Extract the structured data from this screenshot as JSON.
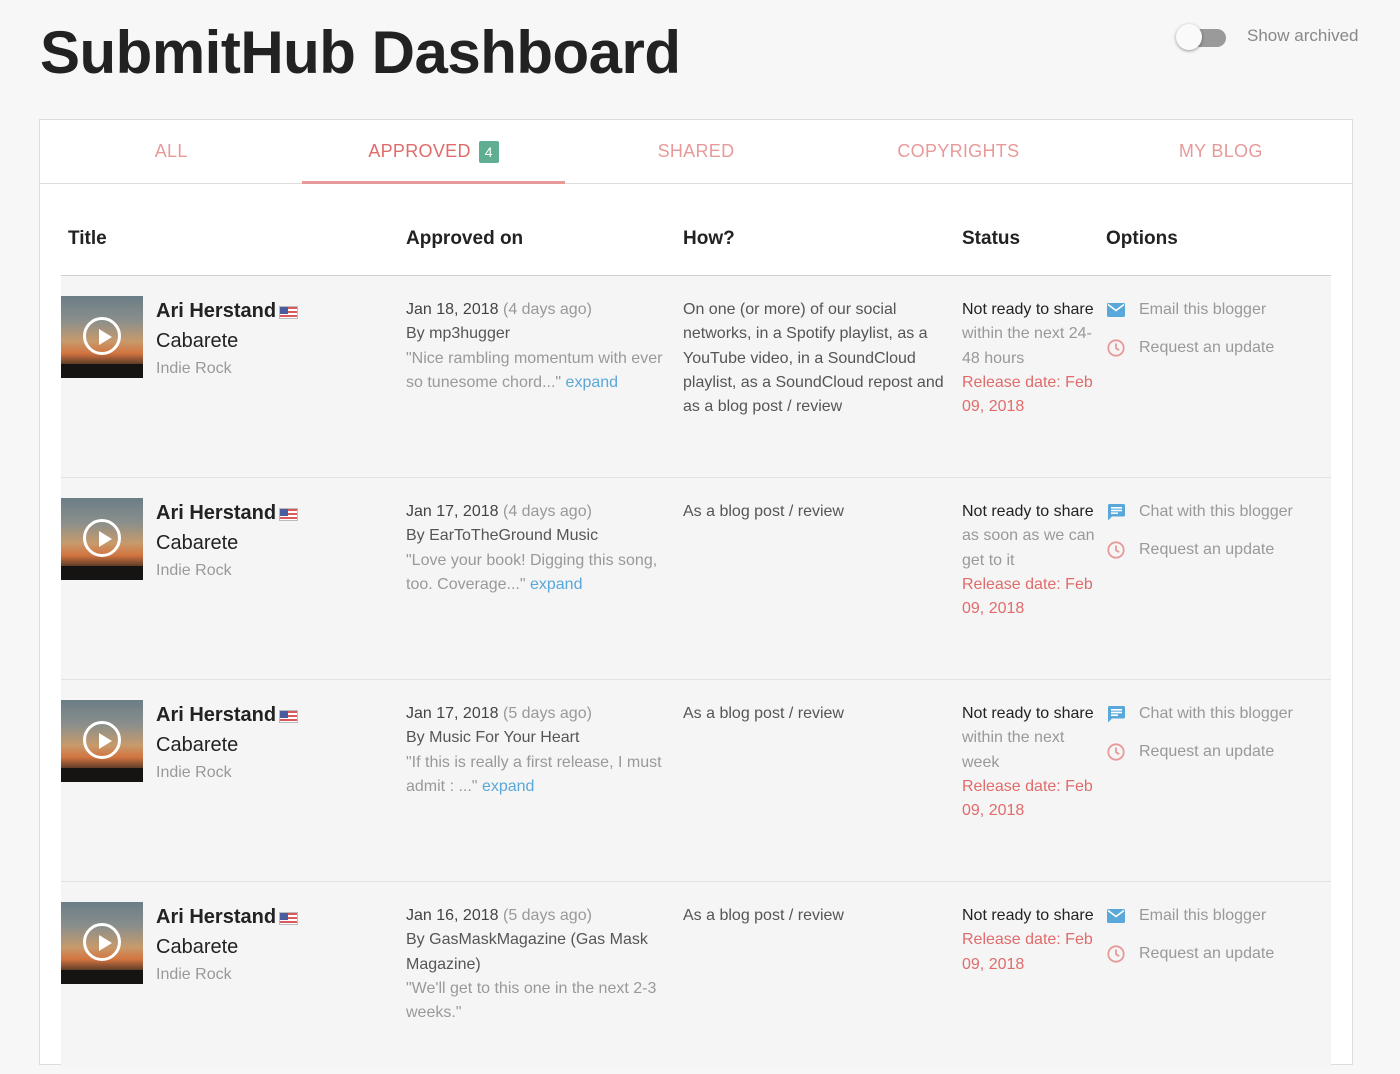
{
  "header": {
    "title": "SubmitHub Dashboard",
    "archive_toggle": {
      "label": "Show archived",
      "checked": false
    }
  },
  "tabs": [
    {
      "label": "ALL",
      "active": false
    },
    {
      "label": "APPROVED",
      "badge": "4",
      "active": true
    },
    {
      "label": "SHARED",
      "active": false
    },
    {
      "label": "COPYRIGHTS",
      "active": false
    },
    {
      "label": "MY BLOG",
      "active": false
    }
  ],
  "table": {
    "columns": [
      "Title",
      "Approved on",
      "How?",
      "Status",
      "Options"
    ],
    "rows": [
      {
        "artist": "Ari Herstand",
        "song": "Cabarete",
        "genre": "Indie Rock",
        "approved_date": "Jan 18, 2018",
        "approved_ago": "(4 days ago)",
        "by": "By mp3hugger",
        "quote": "\"Nice rambling momentum with ever so tunesome chord...\"",
        "expand": "expand",
        "how": "On one (or more) of our social networks, in a Spotify playlist, as a YouTube video, in a SoundCloud playlist, as a SoundCloud repost and as a blog post / review",
        "status": "Not ready to share",
        "timing": "within the next 24-48 hours",
        "release": "Release date: Feb 09, 2018",
        "option1": "Email this blogger",
        "option1_icon": "email-icon",
        "option2": "Request an update",
        "option2_icon": "clock-icon"
      },
      {
        "artist": "Ari Herstand",
        "song": "Cabarete",
        "genre": "Indie Rock",
        "approved_date": "Jan 17, 2018",
        "approved_ago": "(4 days ago)",
        "by": "By EarToTheGround Music",
        "quote": "\"Love your book! Digging this song, too. Coverage...\"",
        "expand": "expand",
        "how": "As a blog post / review",
        "status": "Not ready to share",
        "timing": "as soon as we can get to it",
        "release": "Release date: Feb 09, 2018",
        "option1": "Chat with this blogger",
        "option1_icon": "chat-icon",
        "option2": "Request an update",
        "option2_icon": "clock-icon"
      },
      {
        "artist": "Ari Herstand",
        "song": "Cabarete",
        "genre": "Indie Rock",
        "approved_date": "Jan 17, 2018",
        "approved_ago": "(5 days ago)",
        "by": "By Music For Your Heart",
        "quote": "\"If this is really a first release, I must admit : ...\"",
        "expand": "expand",
        "how": "As a blog post / review",
        "status": "Not ready to share",
        "timing": "within the next week",
        "release": "Release date: Feb 09, 2018",
        "option1": "Chat with this blogger",
        "option1_icon": "chat-icon",
        "option2": "Request an update",
        "option2_icon": "clock-icon"
      },
      {
        "artist": "Ari Herstand",
        "song": "Cabarete",
        "genre": "Indie Rock",
        "approved_date": "Jan 16, 2018",
        "approved_ago": "(5 days ago)",
        "by": "By GasMaskMagazine (Gas Mask Magazine)",
        "quote": "\"We'll get to this one in the next 2-3 weeks.\"",
        "expand": "",
        "how": "As a blog post / review",
        "status": "Not ready to share",
        "timing": "",
        "release": "Release date: Feb 09, 2018",
        "option1": "Email this blogger",
        "option1_icon": "email-icon",
        "option2": "Request an update",
        "option2_icon": "clock-icon"
      }
    ]
  },
  "colors": {
    "accent": "#e79a9a",
    "badge": "#5fae91",
    "link": "#5aa7d9",
    "release": "#e06b6b",
    "icon_blue": "#5aa7d9",
    "icon_red": "#e79a9a"
  }
}
